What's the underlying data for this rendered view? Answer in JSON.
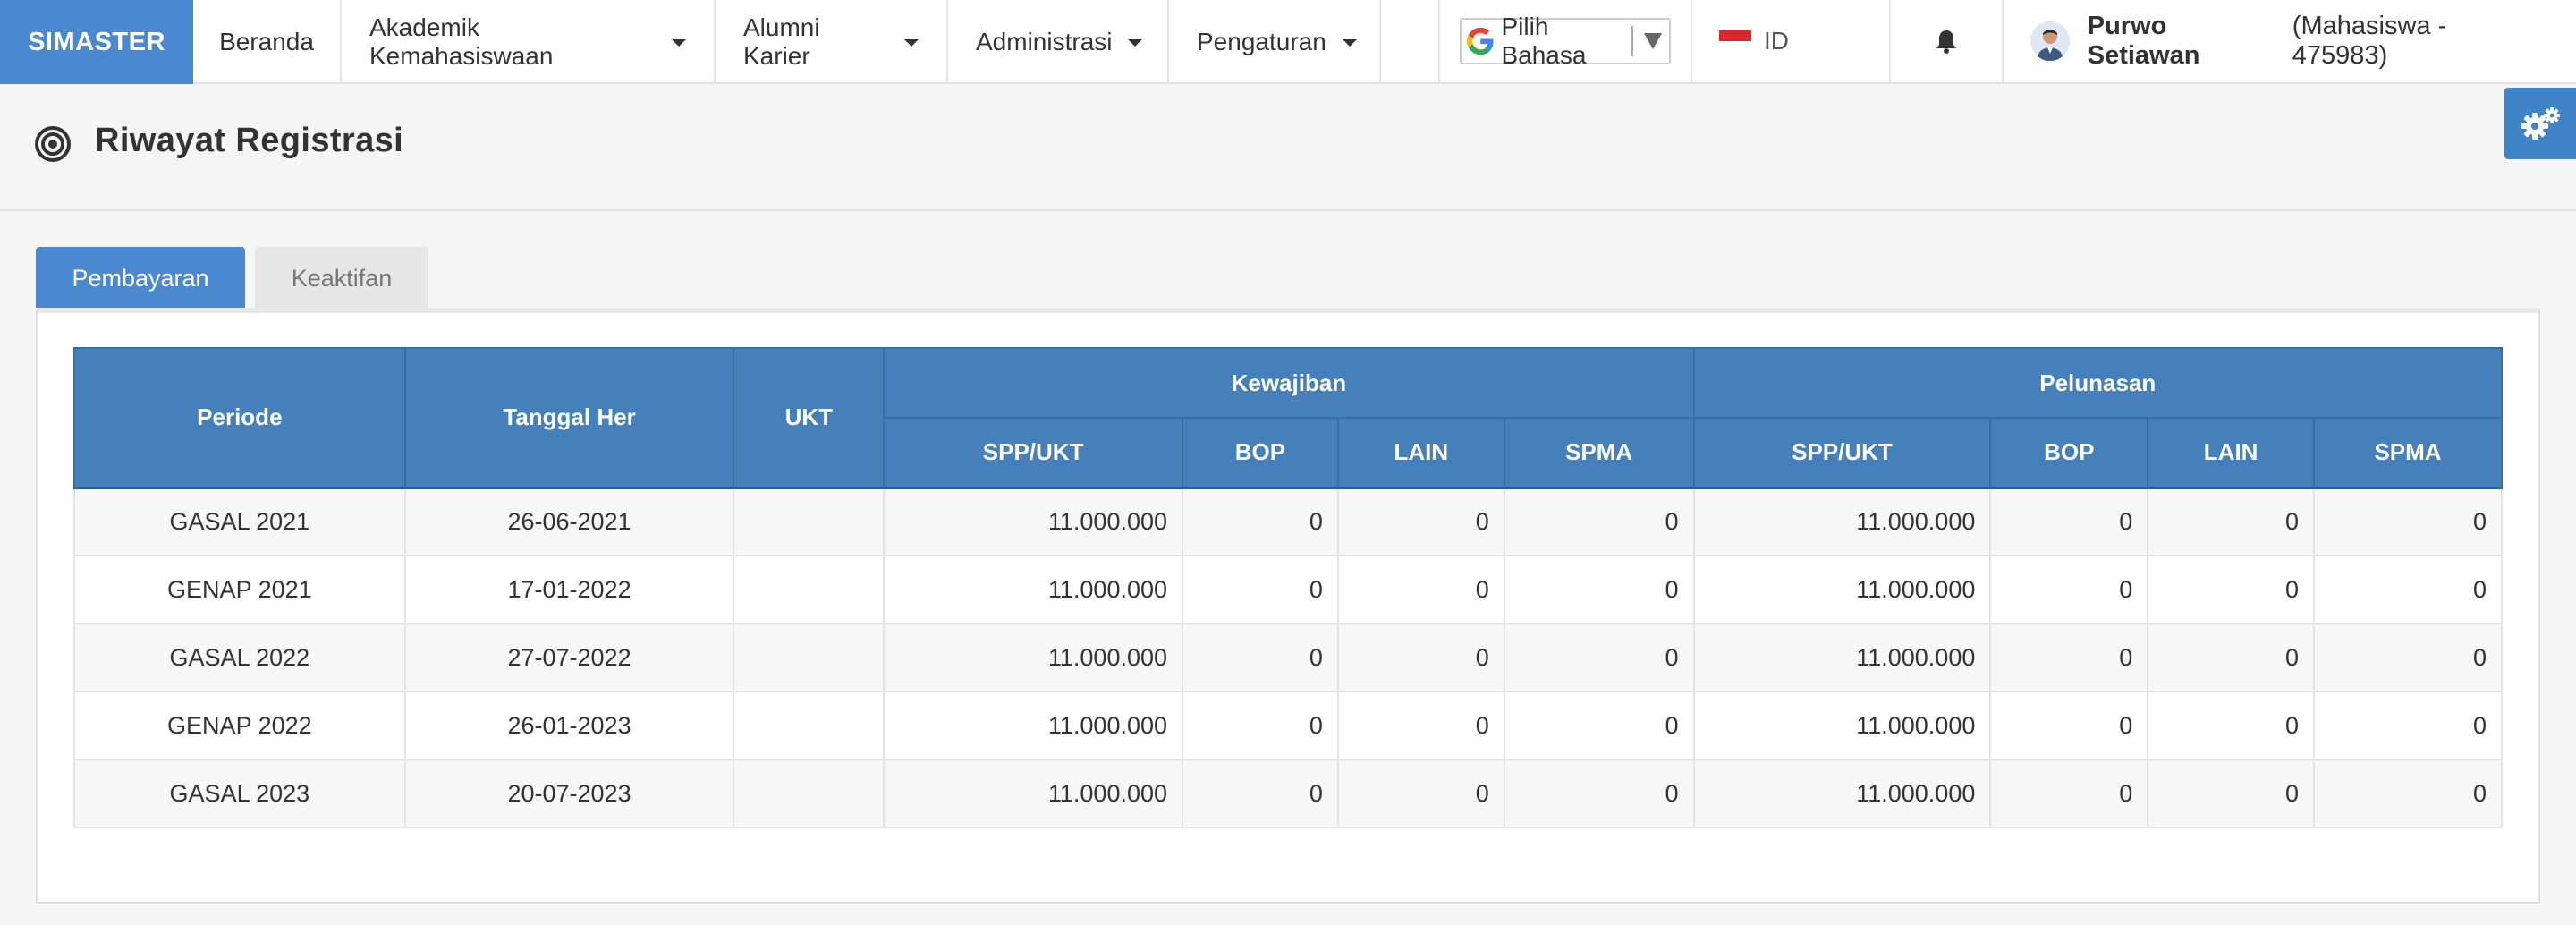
{
  "nav": {
    "brand": "SIMASTER",
    "items": [
      {
        "label": "Beranda",
        "dropdown": false
      },
      {
        "label": "Akademik Kemahasiswaan",
        "dropdown": true
      },
      {
        "label": "Alumni Karier",
        "dropdown": true
      },
      {
        "label": "Administrasi",
        "dropdown": true
      },
      {
        "label": "Pengaturan",
        "dropdown": true
      }
    ],
    "translate_label": "Pilih Bahasa",
    "language_code": "ID",
    "user": {
      "name": "Purwo Setiawan",
      "role": "(Mahasiswa - 475983)"
    }
  },
  "page": {
    "title": "Riwayat Registrasi"
  },
  "tabs": [
    {
      "label": "Pembayaran",
      "active": true
    },
    {
      "label": "Keaktifan",
      "active": false
    }
  ],
  "table": {
    "headers": {
      "periode": "Periode",
      "tanggal_her": "Tanggal Her",
      "ukt": "UKT",
      "kewajiban": "Kewajiban",
      "pelunasan": "Pelunasan",
      "sub": [
        "SPP/UKT",
        "BOP",
        "LAIN",
        "SPMA",
        "SPP/UKT",
        "BOP",
        "LAIN",
        "SPMA"
      ]
    },
    "rows": [
      [
        "GASAL 2021",
        "26-06-2021",
        "",
        "11.000.000",
        "0",
        "0",
        "0",
        "11.000.000",
        "0",
        "0",
        "0"
      ],
      [
        "GENAP 2021",
        "17-01-2022",
        "",
        "11.000.000",
        "0",
        "0",
        "0",
        "11.000.000",
        "0",
        "0",
        "0"
      ],
      [
        "GASAL 2022",
        "27-07-2022",
        "",
        "11.000.000",
        "0",
        "0",
        "0",
        "11.000.000",
        "0",
        "0",
        "0"
      ],
      [
        "GENAP 2022",
        "26-01-2023",
        "",
        "11.000.000",
        "0",
        "0",
        "0",
        "11.000.000",
        "0",
        "0",
        "0"
      ],
      [
        "GASAL 2023",
        "20-07-2023",
        "",
        "11.000.000",
        "0",
        "0",
        "0",
        "11.000.000",
        "0",
        "0",
        "0"
      ]
    ]
  },
  "colors": {
    "brand": "#4a89cf",
    "table_header": "#4580ba",
    "settings_button": "#3f84c7"
  }
}
